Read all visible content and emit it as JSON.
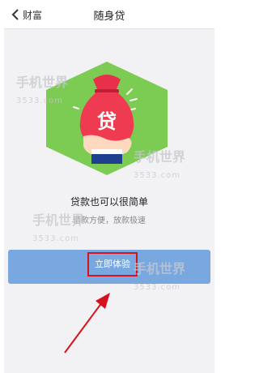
{
  "header": {
    "back_label": "财富",
    "title": "随身贷"
  },
  "illustration": {
    "badge": "贷"
  },
  "main": {
    "headline": "贷款也可以很简单",
    "subline": "借款方便，放款极速",
    "cta_label": "立即体验"
  },
  "watermarks": [
    {
      "text": "手机世界",
      "sub": "3533.com"
    },
    {
      "text": "手机世界",
      "sub": "3533.com"
    },
    {
      "text": "手机世界",
      "sub": "3533.com"
    },
    {
      "text": "手机世界",
      "sub": "3533.com"
    }
  ],
  "colors": {
    "accent": "#79a8e0",
    "annotation": "#d8121c",
    "hexagon": "#7ccb52"
  }
}
